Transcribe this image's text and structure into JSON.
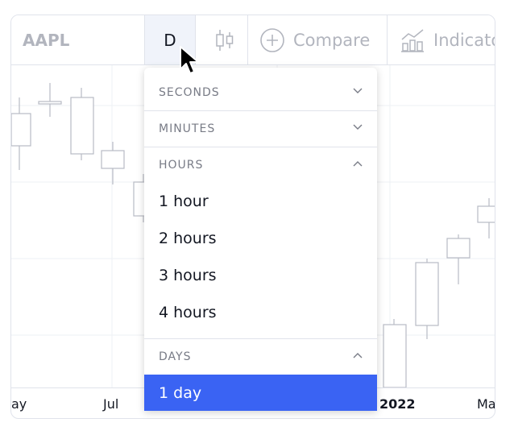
{
  "toolbar": {
    "symbol": "AAPL",
    "interval": "D",
    "compare_label": "Compare",
    "indicators_label": "Indicato"
  },
  "icons": {
    "chart_type": "candles-icon",
    "compare": "plus-circle-icon",
    "indicators": "indicators-chart-icon",
    "cursor": "mouse-pointer-icon"
  },
  "x_axis": {
    "labels": [
      "ay",
      "Jul",
      "2022",
      "Ma"
    ]
  },
  "dropdown": {
    "sections": [
      {
        "title": "SECONDS",
        "expanded": false
      },
      {
        "title": "MINUTES",
        "expanded": false
      },
      {
        "title": "HOURS",
        "expanded": true
      },
      {
        "title": "DAYS",
        "expanded": true
      }
    ],
    "hour_items": [
      "1 hour",
      "2 hours",
      "3 hours",
      "4 hours"
    ],
    "day_items": [
      "1 day"
    ],
    "selected": "1 day"
  },
  "colors": {
    "selection": "#3a63f3",
    "border": "#e0e3eb",
    "muted_text": "#b2b5be",
    "section_text": "#787b86",
    "candle_stroke": "#b8bbc4"
  }
}
